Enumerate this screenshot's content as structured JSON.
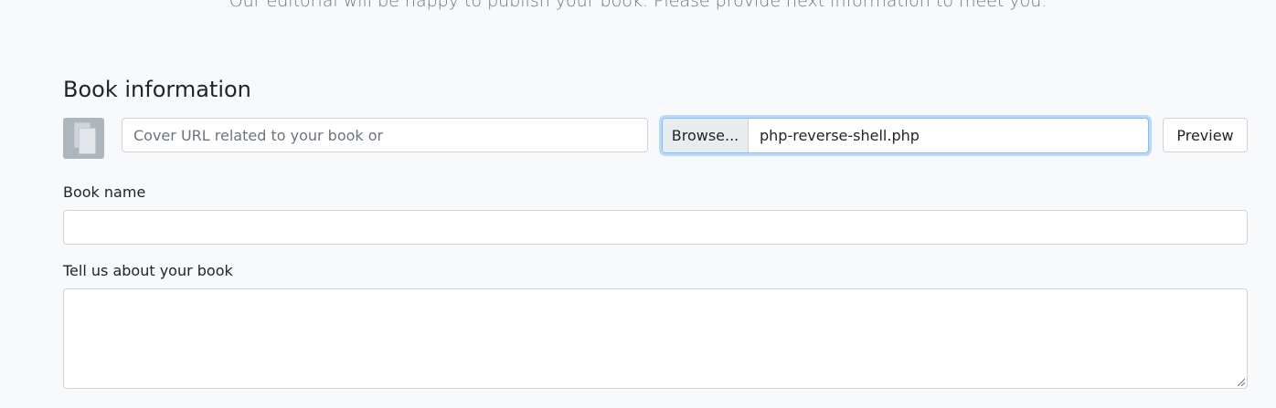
{
  "intro": {
    "text": "Our editorial will be happy to publish your book. Please provide next information to meet you."
  },
  "book_info": {
    "title": "Book information",
    "cover_url": {
      "placeholder": "Cover URL related to your book or",
      "value": ""
    },
    "file": {
      "browse_label": "Browse...",
      "file_name": "php-reverse-shell.php"
    },
    "preview_label": "Preview",
    "book_name": {
      "label": "Book name",
      "value": ""
    },
    "about": {
      "label": "Tell us about your book",
      "value": ""
    }
  },
  "colors": {
    "background": "#f8f9fa",
    "focus_border": "#80bdff",
    "input_border": "#ced4da",
    "cover_placeholder": "#adb5bd"
  },
  "icons": {
    "cover": "book-cover-placeholder-icon",
    "resize": "resize-handle-icon"
  }
}
